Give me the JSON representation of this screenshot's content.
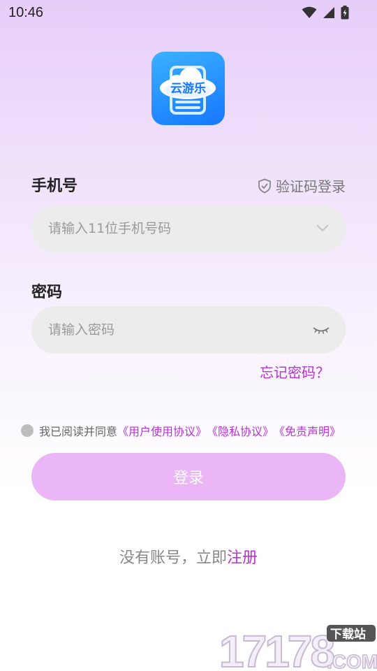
{
  "status_bar": {
    "time": "10:46",
    "icons": [
      "wifi-icon",
      "signal-icon",
      "battery-icon"
    ]
  },
  "app": {
    "logo_text": "云游乐"
  },
  "phone": {
    "label": "手机号",
    "sms_login_label": "验证码登录",
    "placeholder": "请输入11位手机号码"
  },
  "password": {
    "label": "密码",
    "placeholder": "请输入密码",
    "forgot_label": "忘记密码？"
  },
  "agreement": {
    "prefix": "我已阅读并同意",
    "user_agreement": "《用户使用协议》",
    "privacy": "《隐私协议》",
    "disclaimer": "《免责声明》"
  },
  "login_button": "登录",
  "register": {
    "prefix": "没有账号，立即",
    "link": "注册"
  },
  "watermark": {
    "number": "17178",
    "badge": "下载站",
    "suffix": ".COM"
  },
  "colors": {
    "accent": "#b832d6",
    "button": "#ebb6f6",
    "field": "#ececec",
    "logo": "#1677ff"
  }
}
